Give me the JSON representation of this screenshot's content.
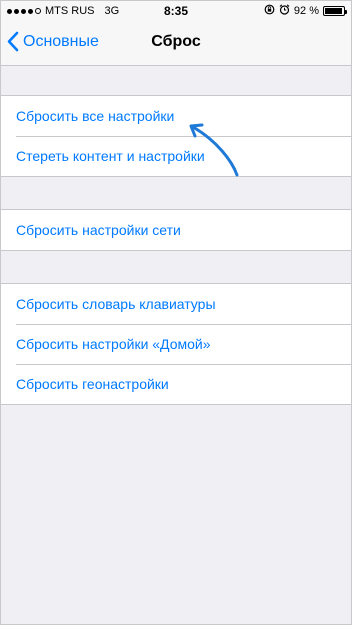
{
  "status_bar": {
    "carrier": "MTS RUS",
    "network": "3G",
    "time": "8:35",
    "battery_percent": "92 %",
    "battery_level": 0.92,
    "signal_bars": 4
  },
  "nav": {
    "back_label": "Основные",
    "title": "Сброс"
  },
  "groups": [
    {
      "items": [
        {
          "label": "Сбросить все настройки"
        },
        {
          "label": "Стереть контент и настройки"
        }
      ]
    },
    {
      "items": [
        {
          "label": "Сбросить настройки сети"
        }
      ]
    },
    {
      "items": [
        {
          "label": "Сбросить словарь клавиатуры"
        },
        {
          "label": "Сбросить настройки «Домой»"
        },
        {
          "label": "Сбросить геонастройки"
        }
      ]
    }
  ],
  "colors": {
    "accent": "#007aff",
    "background": "#efeff4",
    "annotation_arrow": "#1e7ad6"
  }
}
